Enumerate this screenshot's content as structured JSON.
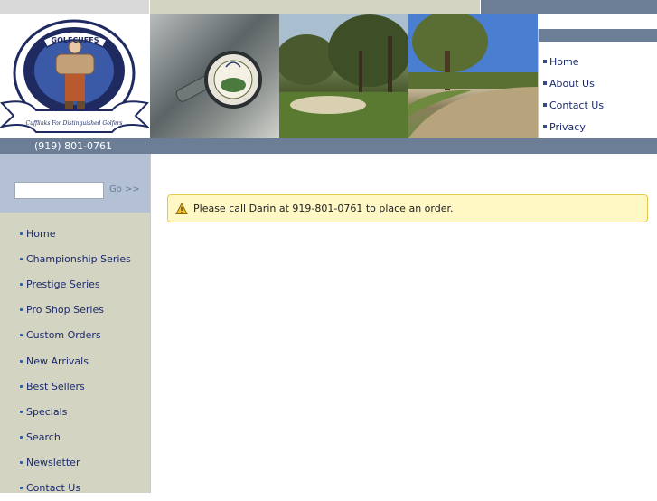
{
  "header": {
    "logo": {
      "text": "GOLFCUFFS",
      "tagline": "Cufflinks For Distinguished Golfers"
    },
    "top_nav": [
      "Home",
      "About Us",
      "Contact Us",
      "Privacy"
    ],
    "phone": "(919) 801-0761"
  },
  "sidebar": {
    "search": {
      "placeholder": "",
      "go_label": "Go >>"
    },
    "menu": [
      "Home",
      "Championship Series",
      "Prestige Series",
      "Pro Shop Series",
      "Custom Orders",
      "New Arrivals",
      "Best Sellers",
      "Specials",
      "Search",
      "Newsletter",
      "Contact Us"
    ]
  },
  "main": {
    "notice": {
      "icon": "warning-icon",
      "text": "Please call Darin at 919-801-0761 to place an order."
    }
  },
  "colors": {
    "slate_blue": "#6b7e96",
    "sidebar_beige": "#d4d4c2",
    "search_blue": "#b4c0d4",
    "link_navy": "#1a2a6e",
    "notice_bg": "#fff8c4",
    "notice_border": "#e6c848"
  }
}
